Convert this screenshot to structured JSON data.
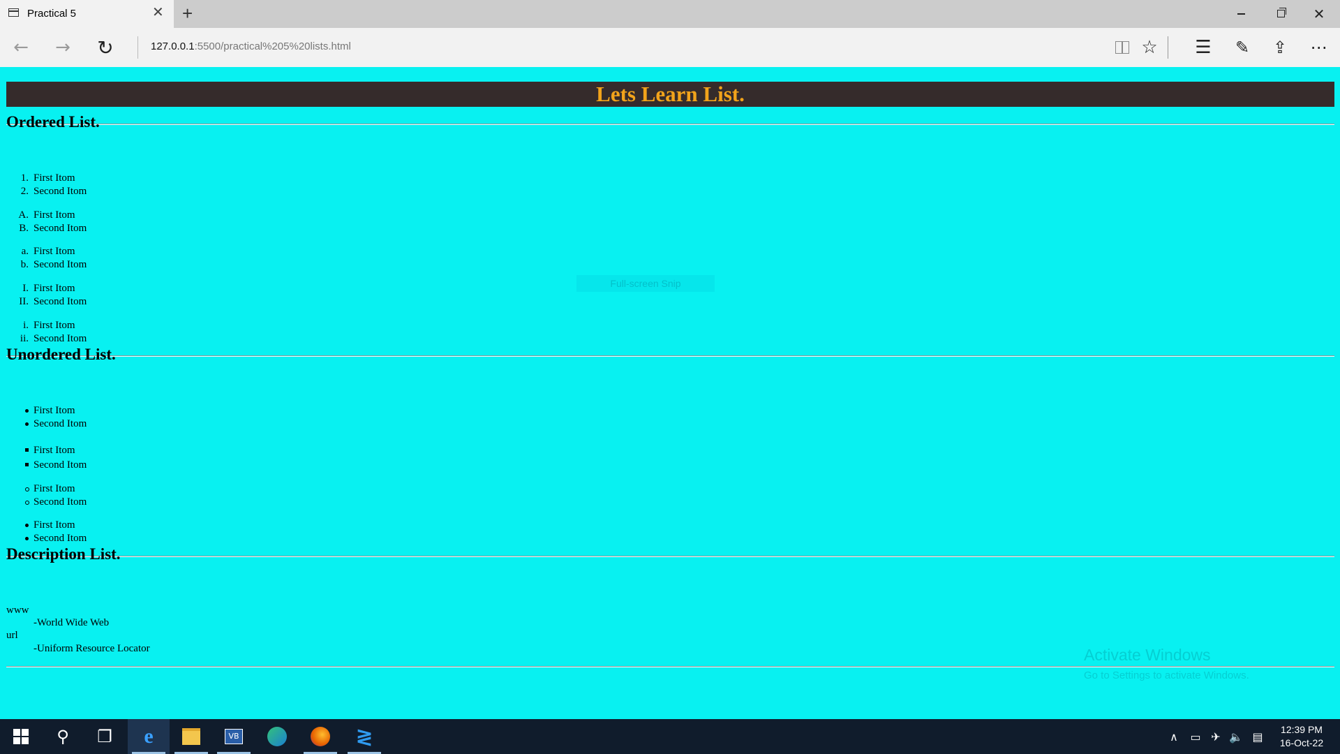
{
  "browser": {
    "tab_title": "Practical 5",
    "tab_close": "✕",
    "new_tab": "+",
    "address_host": "127.0.0.1",
    "address_path": ":5500/practical%205%20lists.html",
    "icons": [
      "back-icon",
      "forward-icon",
      "refresh-icon",
      "reading-view-icon",
      "favorite-star-icon",
      "hub-icon",
      "web-note-icon",
      "share-icon",
      "more-icon"
    ]
  },
  "page": {
    "banner": "Lets Learn List.",
    "ordered_heading": "Ordered List.",
    "ordered_lists": [
      {
        "markers": [
          "1.",
          "2."
        ],
        "items": [
          "First Itom",
          "Second Itom"
        ]
      },
      {
        "markers": [
          "A.",
          "B."
        ],
        "items": [
          "First Itom",
          "Second Itom"
        ]
      },
      {
        "markers": [
          "a.",
          "b."
        ],
        "items": [
          "First Itom",
          "Second Itom"
        ]
      },
      {
        "markers": [
          "I.",
          "II."
        ],
        "items": [
          "First Itom",
          "Second Itom"
        ]
      },
      {
        "markers": [
          "i.",
          "ii."
        ],
        "items": [
          "First Itom",
          "Second Itom"
        ]
      }
    ],
    "unordered_heading": "Unordered List.",
    "unordered_lists": [
      {
        "style": "disc",
        "items": [
          "First Itom",
          "Second Itom"
        ]
      },
      {
        "style": "square",
        "items": [
          "First Itom",
          "Second Itom"
        ]
      },
      {
        "style": "circle",
        "items": [
          "First Itom",
          "Second Itom"
        ]
      },
      {
        "style": "disc",
        "items": [
          "First Itom",
          "Second Itom"
        ]
      }
    ],
    "description_heading": "Description List.",
    "description_list": [
      {
        "term": "www",
        "desc": "-World Wide Web"
      },
      {
        "term": "url",
        "desc": "-Uniform Resource Locator"
      }
    ]
  },
  "overlays": {
    "snip_label": "Full-screen Snip",
    "watermark_title": "Activate Windows",
    "watermark_sub": "Go to Settings to activate Windows."
  },
  "taskbar": {
    "apps": [
      "start-icon",
      "search-icon",
      "task-view-icon",
      "edge-legacy-icon",
      "file-explorer-icon",
      "vb-app-icon",
      "edge-icon",
      "firefox-icon",
      "vscode-icon"
    ],
    "time": "12:39 PM",
    "date": "16-Oct-22"
  },
  "colors": {
    "page_bg": "#08f1f1",
    "banner_bg": "#352b2b",
    "banner_text": "#f2a31b",
    "taskbar_bg": "#101c2c"
  }
}
